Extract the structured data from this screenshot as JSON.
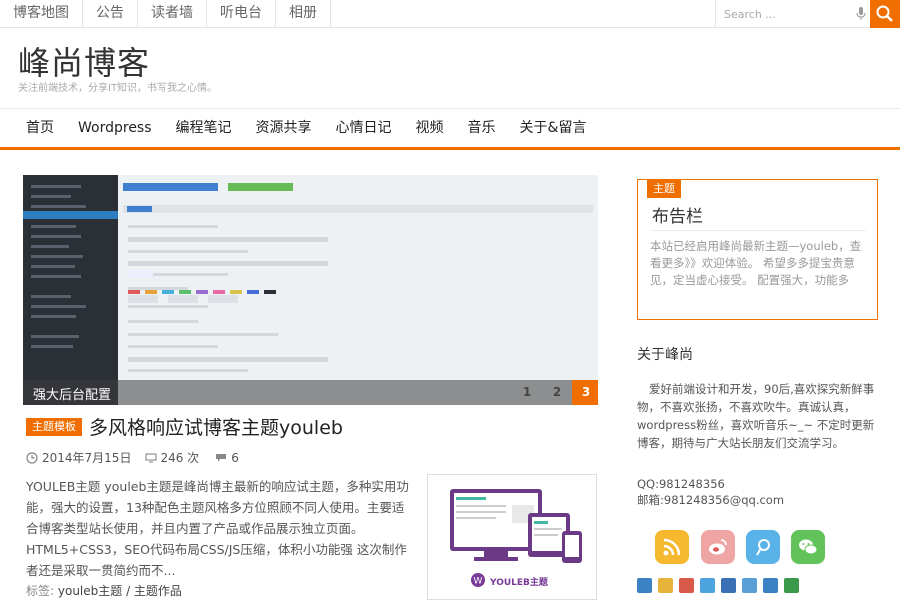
{
  "top_links": [
    "博客地图",
    "公告",
    "读者墙",
    "听电台",
    "相册"
  ],
  "search": {
    "placeholder": "Search ..."
  },
  "site": {
    "title": "峰尚博客",
    "description": "关注前端技术，分享IT知识，书写我之心情。"
  },
  "nav": [
    "首页",
    "Wordpress",
    "编程笔记",
    "资源共享",
    "心情日记",
    "视频",
    "音乐",
    "关于&留言"
  ],
  "slider": {
    "caption": "强大后台配置",
    "pages": [
      "1",
      "2",
      "3"
    ],
    "active_page": "3"
  },
  "post": {
    "category": "主题模板",
    "title": "多风格响应试博客主题youleb",
    "date": "2014年7月15日",
    "views": "246 次",
    "comments": "6",
    "excerpt": "YOULEB主题 youleb主题是峰尚博主最新的响应试主题，多种实用功能，强大的设置，13种配色主题风格多方位照顾不同人使用。主要适合博客类型站长使用，并且内置了产品或作品展示独立页面。 HTML5+CSS3，SEO代码布局CSS/JS压缩，体积小功能强 这次制作者还是采取一贯简约而不...",
    "tags_label": "标签:",
    "tags": "youleb主题 / 主题作品",
    "thumb_label": "YOULEB主题"
  },
  "notice": {
    "tag": "主题",
    "title": "布告栏",
    "text": "本站已经启用峰尚最新主题—youleb，查看更多》》欢迎体验。 希望多多提宝贵意见，定当虚心接受。 配置强大，功能多"
  },
  "about": {
    "title": "关于峰尚",
    "text": "爱好前端设计和开发，90后,喜欢探究新鲜事物，不喜欢张扬，不喜欢吹牛。真诚认真，wordpress粉丝，喜欢听音乐~_~ 不定时更新博客，期待与广大站长朋友们交流学习。",
    "qq": "QQ:981248356",
    "email": "邮箱:981248356@qq.com"
  },
  "social_icons": [
    "rss-icon",
    "weibo-icon",
    "tencent-weibo-icon",
    "wechat-icon"
  ],
  "colors": {
    "accent": "#f06d00",
    "rss": "#f5b82e",
    "weibo": "#f0a5a5",
    "tweibo": "#5ab3e8",
    "wechat": "#62c35a"
  }
}
